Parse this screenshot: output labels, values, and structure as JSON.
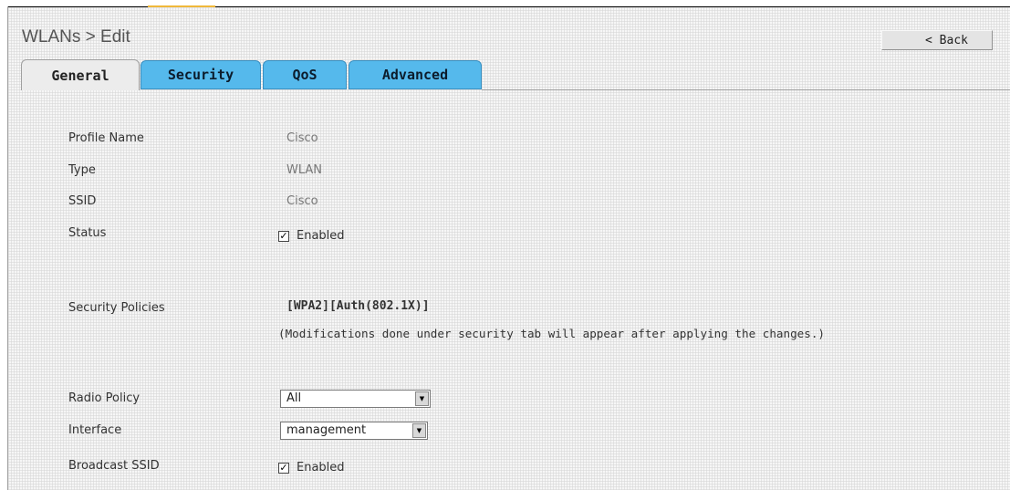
{
  "header": {
    "title": "WLANs > Edit",
    "back_label": "< Back"
  },
  "tabs": [
    {
      "label": "General",
      "active": true
    },
    {
      "label": "Security",
      "active": false
    },
    {
      "label": "QoS",
      "active": false
    },
    {
      "label": "Advanced",
      "active": false
    }
  ],
  "general": {
    "profile_name_label": "Profile Name",
    "profile_name_value": "Cisco",
    "type_label": "Type",
    "type_value": "WLAN",
    "ssid_label": "SSID",
    "ssid_value": "Cisco",
    "status_label": "Status",
    "status_enabled": true,
    "status_checkbox_label": "Enabled",
    "security_policies_label": "Security Policies",
    "security_policies_value": "[WPA2][Auth(802.1X)]",
    "security_policies_note": "(Modifications done under security tab will appear after applying the changes.)",
    "radio_policy_label": "Radio Policy",
    "radio_policy_value": "All",
    "interface_label": "Interface",
    "interface_value": "management",
    "broadcast_ssid_label": "Broadcast SSID",
    "broadcast_ssid_enabled": true,
    "broadcast_ssid_checkbox_label": "Enabled"
  },
  "colors": {
    "tab_inactive": "#55b9ec",
    "tab_active": "#ececec",
    "accent": "#f0b83a"
  },
  "icons": {
    "dropdown": "dropdown-arrow-icon",
    "checkbox": "checkmark-icon"
  }
}
